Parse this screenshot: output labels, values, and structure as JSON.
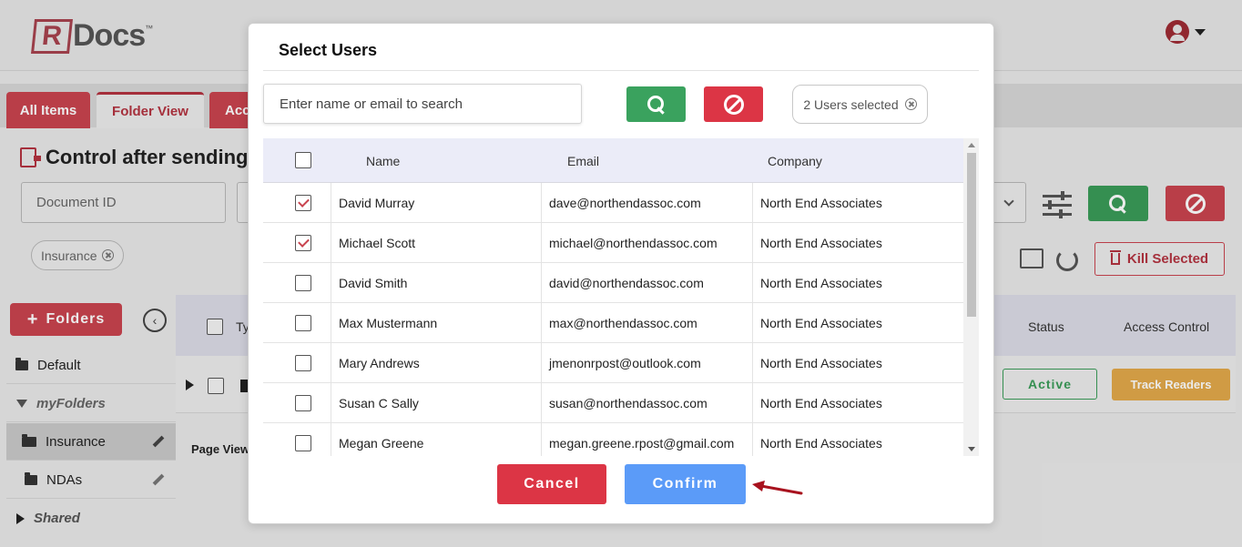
{
  "app": {
    "logo_letter": "R",
    "logo_text": "Docs",
    "logo_tm": "™"
  },
  "tabs": [
    {
      "label": "All Items"
    },
    {
      "label": "Folder View"
    },
    {
      "label": "Acc"
    }
  ],
  "page": {
    "title": "Control after sending",
    "doc_id_placeholder": "Document ID",
    "filter_chip": "Insurance",
    "kill_selected_label": "Kill Selected",
    "page_view_label": "Page View:"
  },
  "sidebar": {
    "folders_button": "Folders",
    "items": [
      {
        "label": "Default"
      },
      {
        "label": "myFolders"
      },
      {
        "label": "Insurance"
      },
      {
        "label": "NDAs"
      },
      {
        "label": "Shared"
      }
    ]
  },
  "bg_table": {
    "col_type_partial": "Ty",
    "col_status": "Status",
    "col_access": "Access Control",
    "row_status": "Active",
    "row_track": "Track Readers"
  },
  "modal": {
    "title": "Select Users",
    "search_placeholder": "Enter name or email to search",
    "selected_count": "2 Users selected",
    "columns": {
      "name": "Name",
      "email": "Email",
      "company": "Company"
    },
    "rows": [
      {
        "name": "David Murray",
        "email": "dave@northendassoc.com",
        "company": "North End Associates",
        "checked": true
      },
      {
        "name": "Michael Scott",
        "email": "michael@northendassoc.com",
        "company": "North End Associates",
        "checked": true
      },
      {
        "name": "David Smith",
        "email": "david@northendassoc.com",
        "company": "North End Associates",
        "checked": false
      },
      {
        "name": "Max Mustermann",
        "email": "max@northendassoc.com",
        "company": "North End Associates",
        "checked": false
      },
      {
        "name": "Mary Andrews",
        "email": "jmenonrpost@outlook.com",
        "company": "North End Associates",
        "checked": false
      },
      {
        "name": "Susan C Sally",
        "email": "susan@northendassoc.com",
        "company": "North End Associates",
        "checked": false
      },
      {
        "name": "Megan Greene",
        "email": "megan.greene.rpost@gmail.com",
        "company": "North End Associates",
        "checked": false
      }
    ],
    "cancel_label": "Cancel",
    "confirm_label": "Confirm"
  },
  "colors": {
    "brand_red": "#c9444f",
    "danger": "#dc3545",
    "success": "#3aa25e",
    "primary": "#5b9bf8",
    "warning": "#e2a94a",
    "arrow": "#a8121e"
  }
}
